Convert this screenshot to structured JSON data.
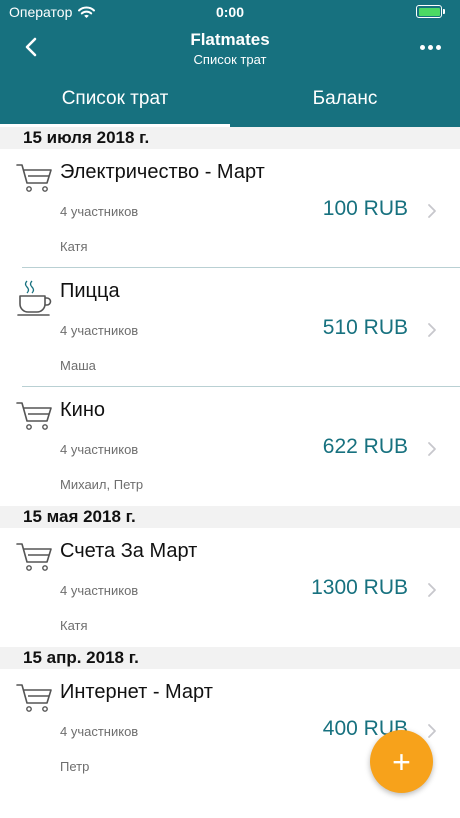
{
  "status_bar": {
    "carrier": "Оператор",
    "time": "0:00"
  },
  "nav": {
    "title": "Flatmates",
    "subtitle": "Список трат"
  },
  "tabs": [
    {
      "label": "Список трат",
      "active": true
    },
    {
      "label": "Баланс",
      "active": false
    }
  ],
  "sections": [
    {
      "date": "15 июля 2018 г.",
      "expenses": [
        {
          "title": "Электричество - Март",
          "participants": "4 участников",
          "amount": "100 RUB",
          "payer": "Катя",
          "icon": "cart-icon"
        },
        {
          "title": "Пицца",
          "participants": "4 участников",
          "amount": "510 RUB",
          "payer": "Маша",
          "icon": "cup-icon"
        },
        {
          "title": "Кино",
          "participants": "4 участников",
          "amount": "622 RUB",
          "payer": "Михаил, Петр",
          "icon": "cart-icon"
        }
      ]
    },
    {
      "date": "15 мая 2018 г.",
      "expenses": [
        {
          "title": "Счета За Март",
          "participants": "4 участников",
          "amount": "1300 RUB",
          "payer": "Катя",
          "icon": "cart-icon"
        }
      ]
    },
    {
      "date": "15 апр. 2018 г.",
      "expenses": [
        {
          "title": "Интернет - Март",
          "participants": "4 участников",
          "amount": "400 RUB",
          "payer": "Петр",
          "icon": "cart-icon"
        }
      ]
    }
  ],
  "fab": {
    "label": "+"
  },
  "colors": {
    "header": "#17717f",
    "accent": "#17717f",
    "fab": "#f7a21b",
    "battery": "#4cd964"
  }
}
